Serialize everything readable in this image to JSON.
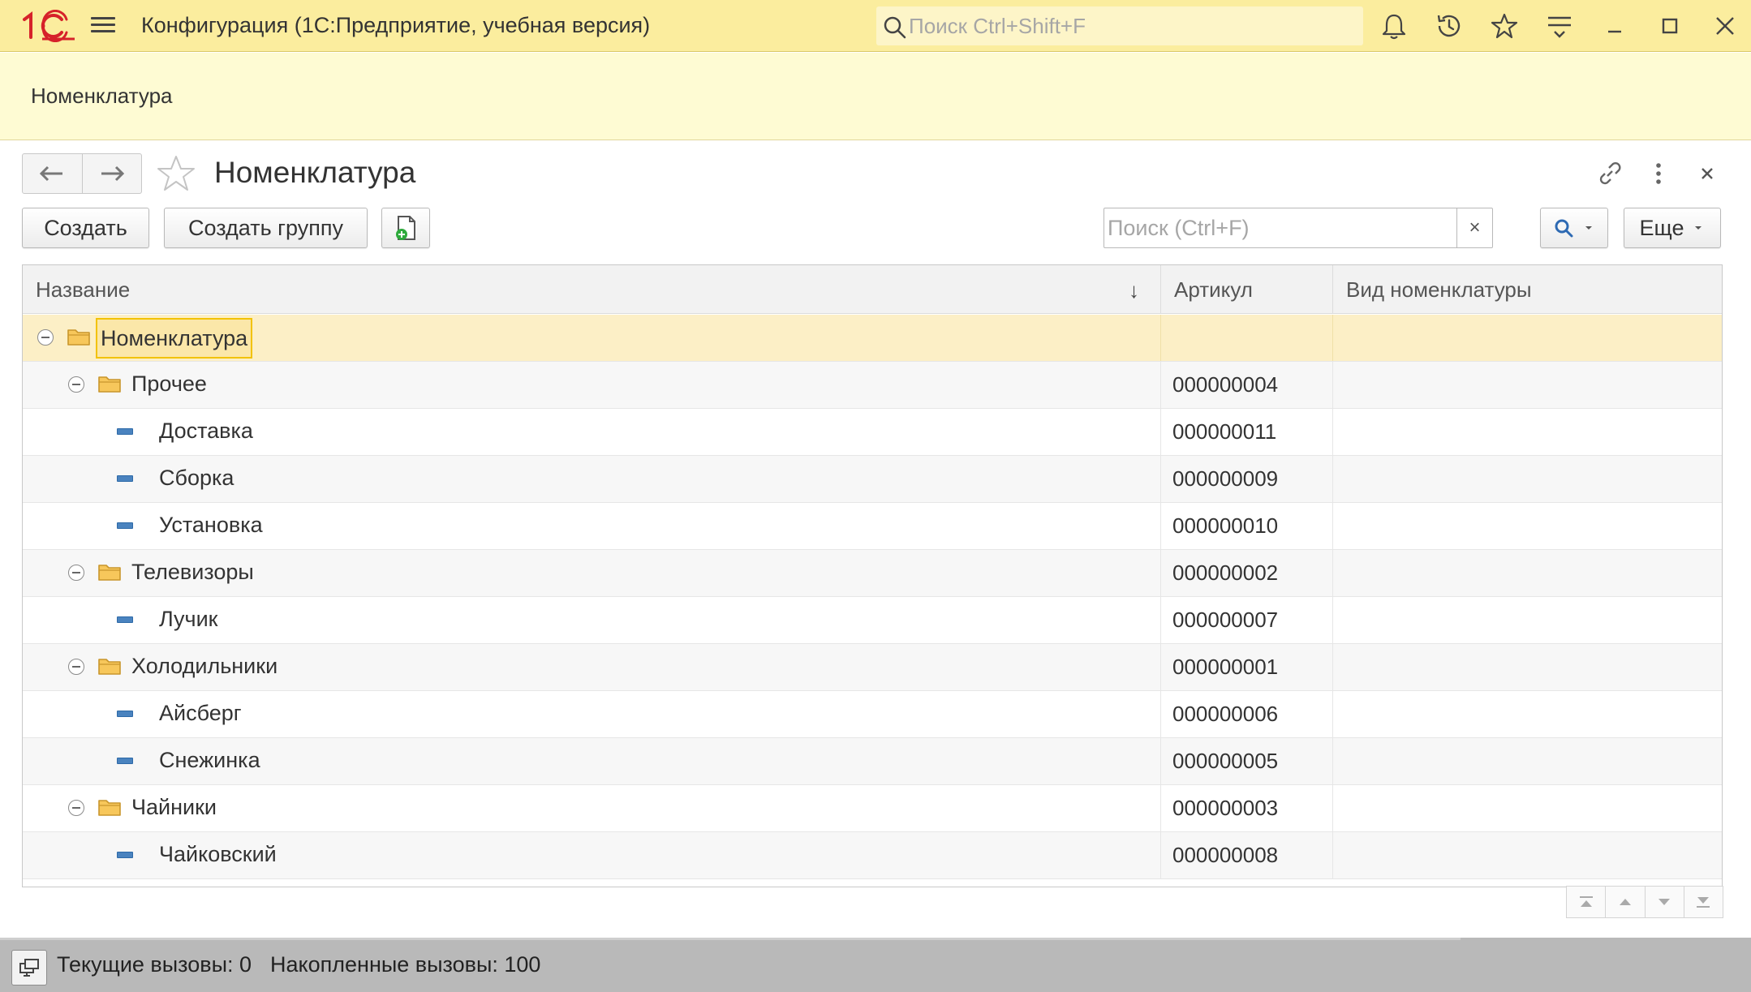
{
  "window": {
    "title": "Конфигурация  (1С:Предприятие, учебная версия)",
    "logo_text": "1С",
    "search_placeholder": "Поиск Ctrl+Shift+F",
    "icons": [
      "bell-icon",
      "history-icon",
      "star-icon",
      "settings-list-icon",
      "minimize-icon",
      "maximize-icon",
      "close-icon"
    ]
  },
  "section_panel": {
    "items": [
      {
        "label": "Номенклатура"
      }
    ]
  },
  "form": {
    "title": "Номенклатура",
    "buttons": {
      "create": "Создать",
      "create_group": "Создать группу",
      "more": "Еще"
    },
    "search": {
      "placeholder": "Поиск (Ctrl+F)",
      "clear": "×"
    }
  },
  "table": {
    "columns": {
      "name": "Название",
      "article": "Артикул",
      "kind": "Вид номенклатуры"
    },
    "sort_indicator": "↓",
    "rows": [
      {
        "level": 0,
        "type": "group",
        "name": "Номенклатура",
        "article": "",
        "kind": "",
        "expanded": true,
        "selected": true
      },
      {
        "level": 1,
        "type": "group",
        "name": "Прочее",
        "article": "000000004",
        "kind": "",
        "expanded": true
      },
      {
        "level": 2,
        "type": "item",
        "name": "Доставка",
        "article": "000000011",
        "kind": ""
      },
      {
        "level": 2,
        "type": "item",
        "name": "Сборка",
        "article": "000000009",
        "kind": ""
      },
      {
        "level": 2,
        "type": "item",
        "name": "Установка",
        "article": "000000010",
        "kind": ""
      },
      {
        "level": 1,
        "type": "group",
        "name": "Телевизоры",
        "article": "000000002",
        "kind": "",
        "expanded": true
      },
      {
        "level": 2,
        "type": "item",
        "name": "Лучик",
        "article": "000000007",
        "kind": ""
      },
      {
        "level": 1,
        "type": "group",
        "name": "Холодильники",
        "article": "000000001",
        "kind": "",
        "expanded": true
      },
      {
        "level": 2,
        "type": "item",
        "name": "Айсберг",
        "article": "000000006",
        "kind": ""
      },
      {
        "level": 2,
        "type": "item",
        "name": "Снежинка",
        "article": "000000005",
        "kind": ""
      },
      {
        "level": 1,
        "type": "group",
        "name": "Чайники",
        "article": "000000003",
        "kind": "",
        "expanded": true
      },
      {
        "level": 2,
        "type": "item",
        "name": "Чайковский",
        "article": "000000008",
        "kind": ""
      }
    ]
  },
  "status_bar": {
    "current_calls": "Текущие вызовы: 0",
    "accumulated_calls": "Накопленные вызовы: 100"
  },
  "colors": {
    "titlebar": "#fbed9e",
    "section_panel": "#fefbd3",
    "selected_row": "#fcefc6",
    "focus_border": "#f2c200",
    "logo_red": "#d6222a",
    "folder": "#f7c75b",
    "item_icon": "#4a83bf",
    "statusbar": "#b9b9b9"
  }
}
